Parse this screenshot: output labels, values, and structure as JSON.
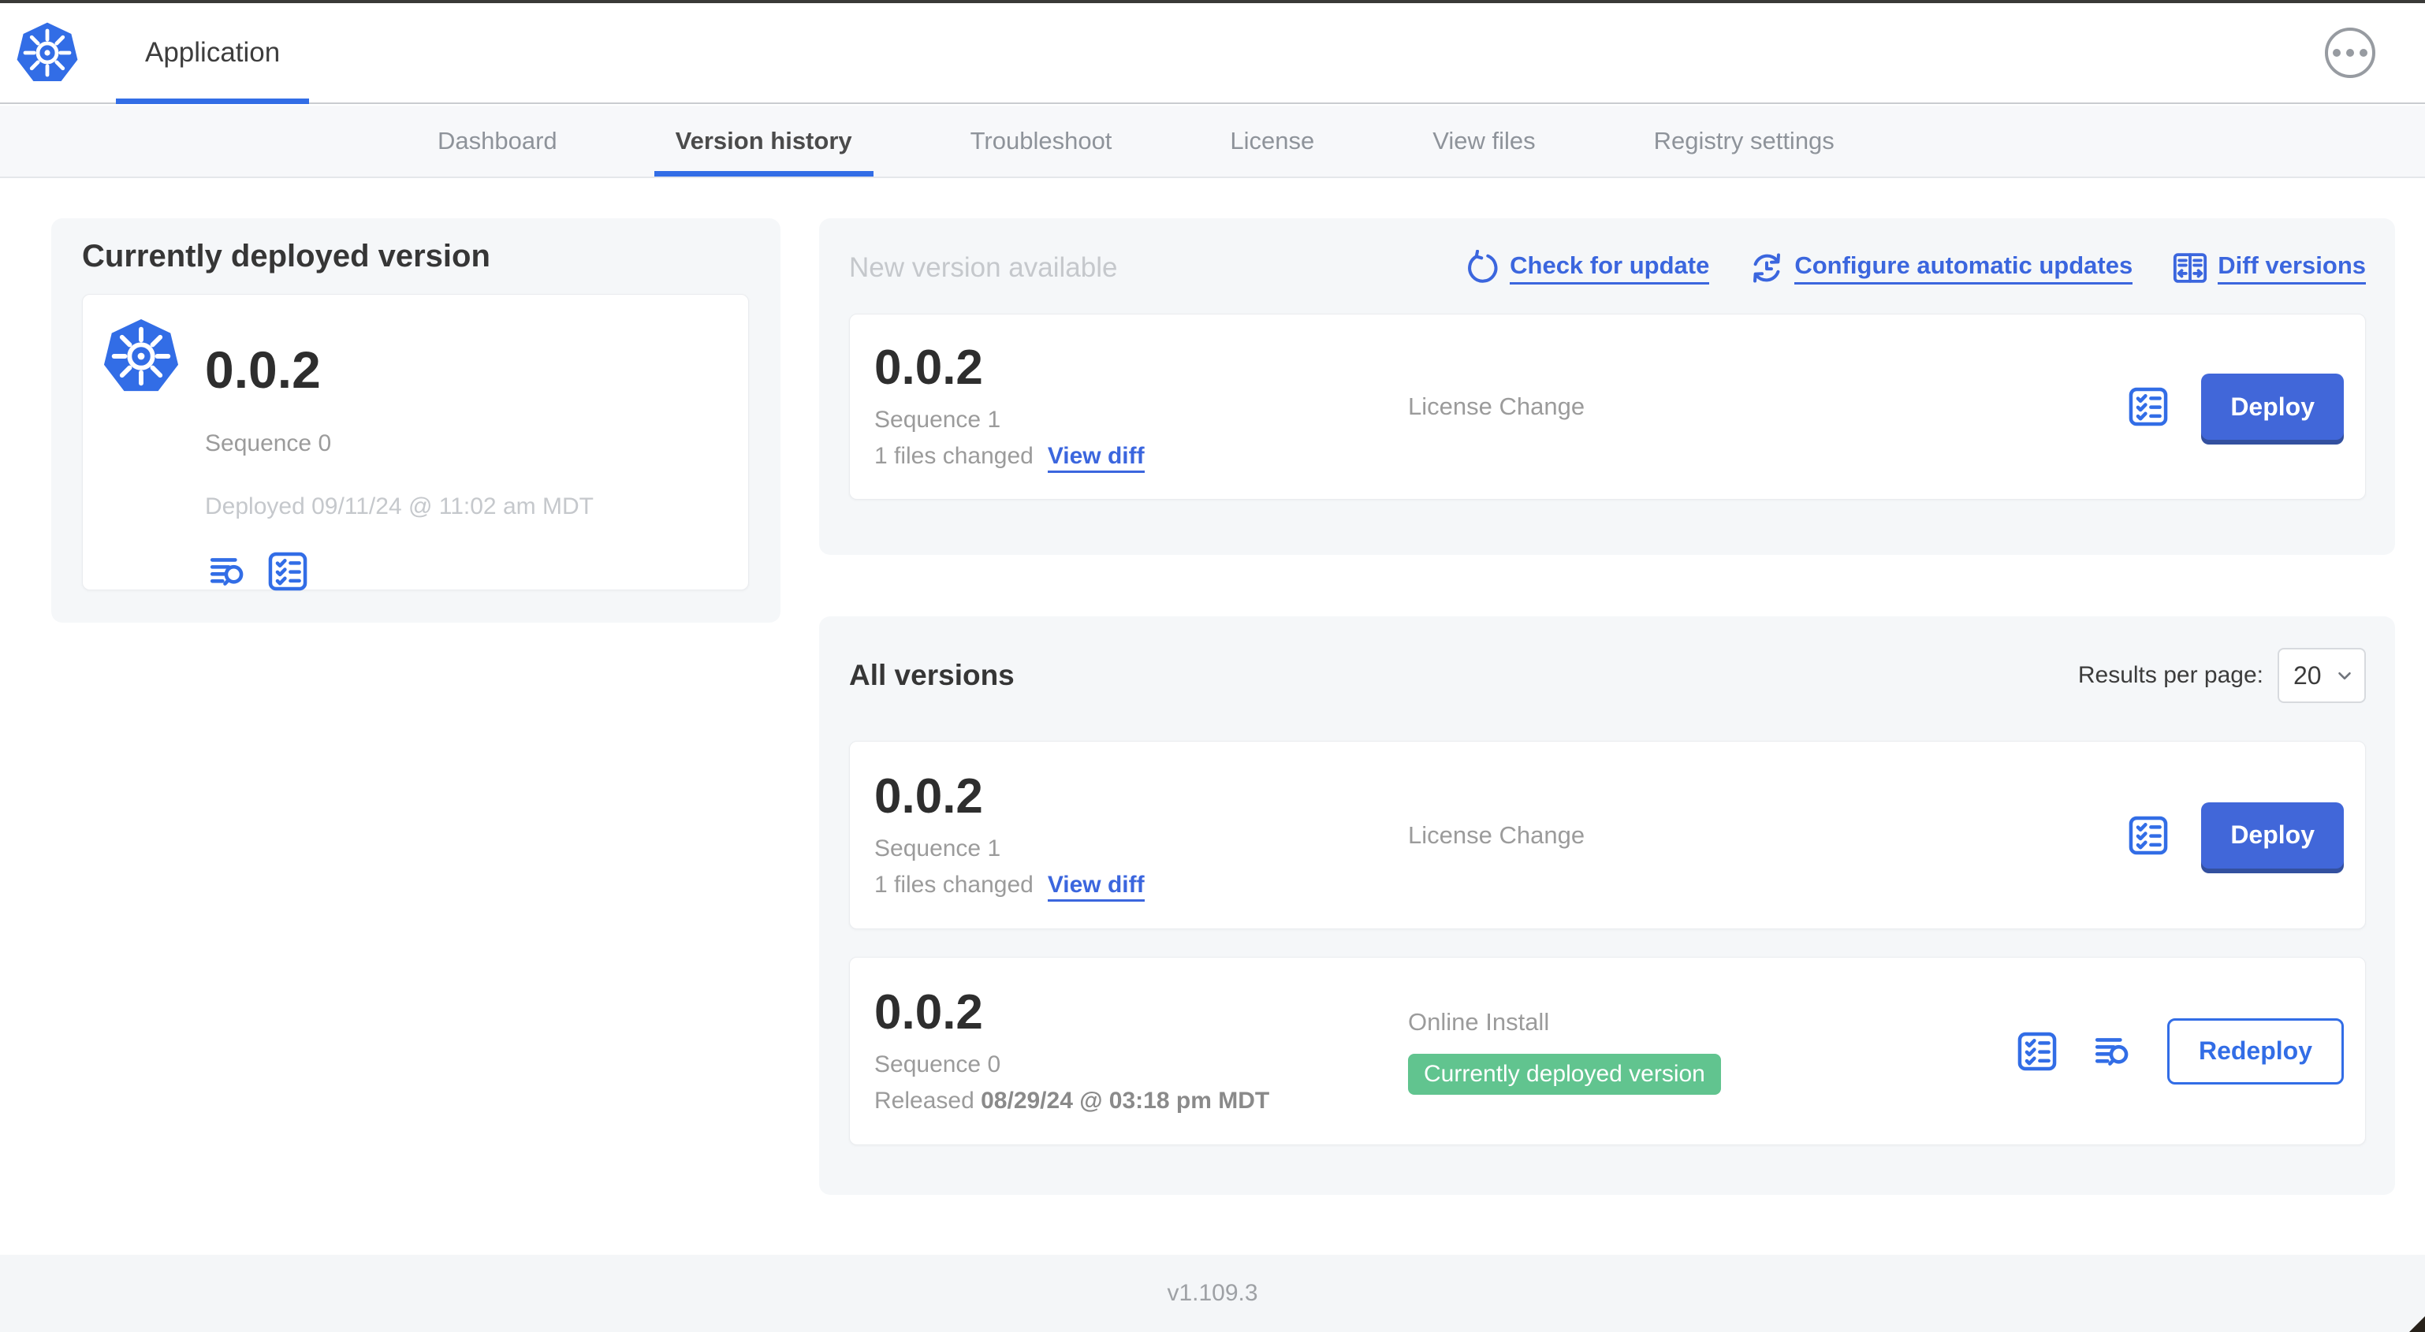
{
  "colors": {
    "accent_blue": "#326de6",
    "link_blue": "#3b66de",
    "button_blue": "#4167d9",
    "badge_green": "#61c48f",
    "panel_bg": "#f5f7f9",
    "muted_text": "#9b9b9b",
    "faint_text": "#c5c8cc"
  },
  "header": {
    "app_tab": "Application"
  },
  "nav": {
    "tabs": [
      {
        "label": "Dashboard",
        "active": false
      },
      {
        "label": "Version history",
        "active": true
      },
      {
        "label": "Troubleshoot",
        "active": false
      },
      {
        "label": "License",
        "active": false
      },
      {
        "label": "View files",
        "active": false
      },
      {
        "label": "Registry settings",
        "active": false
      }
    ]
  },
  "current_version_panel": {
    "title": "Currently deployed version",
    "version": "0.0.2",
    "sequence": "Sequence 0",
    "deployed": "Deployed 09/11/24 @ 11:02 am MDT",
    "icons": [
      "logs-icon",
      "checklist-icon"
    ]
  },
  "new_version_panel": {
    "title": "New version available",
    "actions": {
      "check": "Check for update",
      "configure": "Configure automatic updates",
      "diff": "Diff versions"
    },
    "row": {
      "version": "0.0.2",
      "sequence": "Sequence 1",
      "files_changed": "1 files changed",
      "view_diff": "View diff",
      "source": "License Change",
      "action": "Deploy"
    }
  },
  "all_versions_panel": {
    "title": "All versions",
    "results_per_page_label": "Results per page:",
    "results_per_page_value": "20",
    "rows": [
      {
        "version": "0.0.2",
        "sequence": "Sequence 1",
        "files_changed": "1 files changed",
        "view_diff": "View diff",
        "source": "License Change",
        "action": "Deploy"
      },
      {
        "version": "0.0.2",
        "sequence": "Sequence 0",
        "released_prefix": "Released",
        "released_date": "08/29/24 @ 03:18 pm MDT",
        "source": "Online Install",
        "badge": "Currently deployed version",
        "action": "Redeploy"
      }
    ]
  },
  "footer": {
    "app_version": "v1.109.3"
  }
}
